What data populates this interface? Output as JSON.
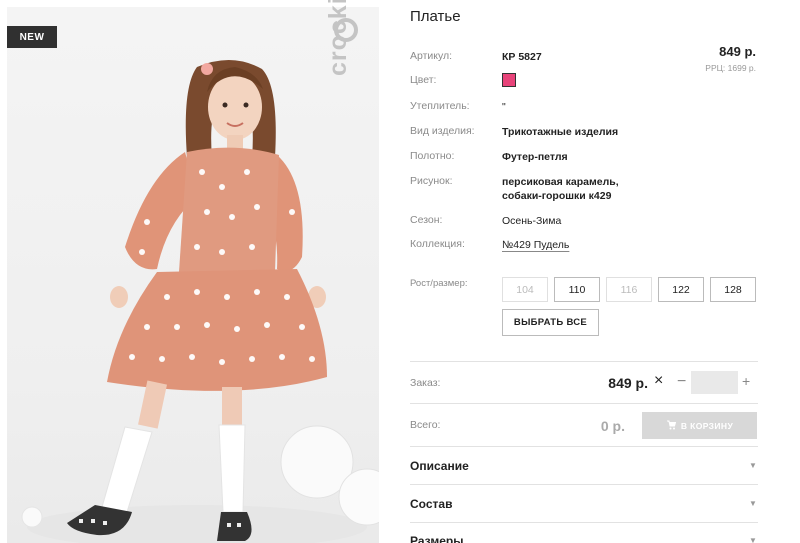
{
  "badge": "NEW",
  "brand": "crockid",
  "product": {
    "title": "Платье",
    "attributes": [
      {
        "label": "Артикул:",
        "value": "КР 5827"
      },
      {
        "label": "Цвет:",
        "value": ""
      },
      {
        "label": "Утеплитель:",
        "value": "\""
      },
      {
        "label": "Вид изделия:",
        "value": "Трикотажные изделия"
      },
      {
        "label": "Полотно:",
        "value": "Футер-петля"
      },
      {
        "label": "Рисунок:",
        "value": "персиковая карамель,\nсобаки-горошки к429"
      },
      {
        "label": "Сезон:",
        "value": "Осень-Зима"
      },
      {
        "label": "Коллекция:",
        "value": "№429 Пудель"
      }
    ],
    "swatch_color": "#e8447a",
    "price": "849 р.",
    "rrp": "РРЦ: 1699 р."
  },
  "sizes": {
    "label": "Рост/размер:",
    "options": [
      {
        "value": "104",
        "available": false
      },
      {
        "value": "110",
        "available": true
      },
      {
        "value": "116",
        "available": false
      },
      {
        "value": "122",
        "available": true
      },
      {
        "value": "128",
        "available": true
      }
    ],
    "select_all": "ВЫБРАТЬ ВСЕ"
  },
  "order": {
    "label": "Заказ:",
    "price": "849 р.",
    "times": "×",
    "minus": "−",
    "plus": "+",
    "quantity": ""
  },
  "total": {
    "label": "Всего:",
    "value": "0 р.",
    "cart_button": "В КОРЗИНУ"
  },
  "accordion": [
    "Описание",
    "Состав",
    "Размеры"
  ],
  "icons": {
    "cart": "cart-icon",
    "arrow": "chevron-down-icon"
  }
}
